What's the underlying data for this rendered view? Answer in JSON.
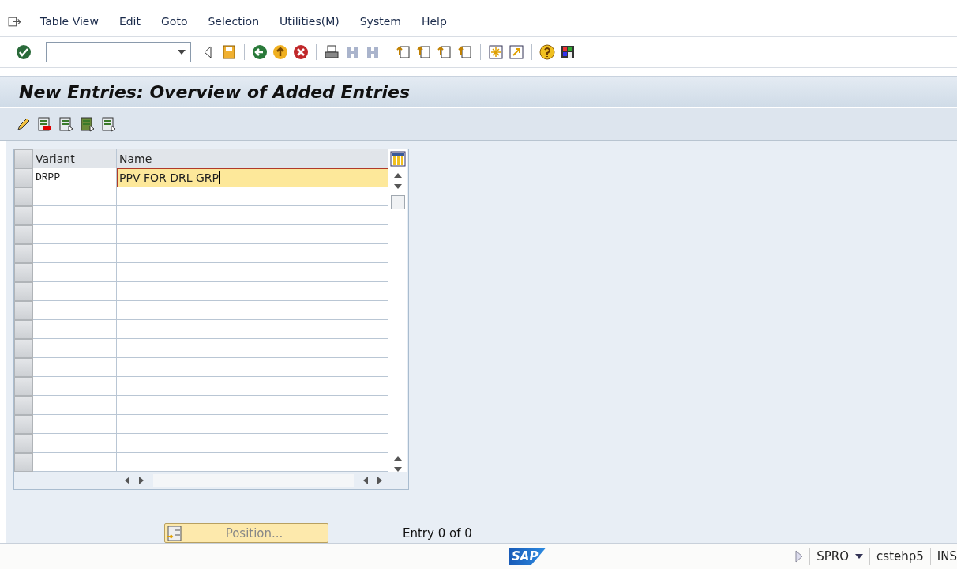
{
  "menu": [
    {
      "label": "Table View"
    },
    {
      "label": "Edit"
    },
    {
      "label": "Goto"
    },
    {
      "label": "Selection"
    },
    {
      "label": "Utilities(M)"
    },
    {
      "label": "System"
    },
    {
      "label": "Help"
    }
  ],
  "title": "New Entries: Overview of Added Entries",
  "table": {
    "columns": [
      "Variant",
      "Name"
    ],
    "rows": [
      {
        "cells": [
          "DRPP",
          "PPV FOR DRL GRP"
        ],
        "selected": true
      }
    ]
  },
  "position_button": "Position...",
  "entry_info": "Entry 0 of 0",
  "status_bar": {
    "logo": "SAP",
    "transaction": "SPRO",
    "server": "cstehp5",
    "mode": "INS"
  }
}
